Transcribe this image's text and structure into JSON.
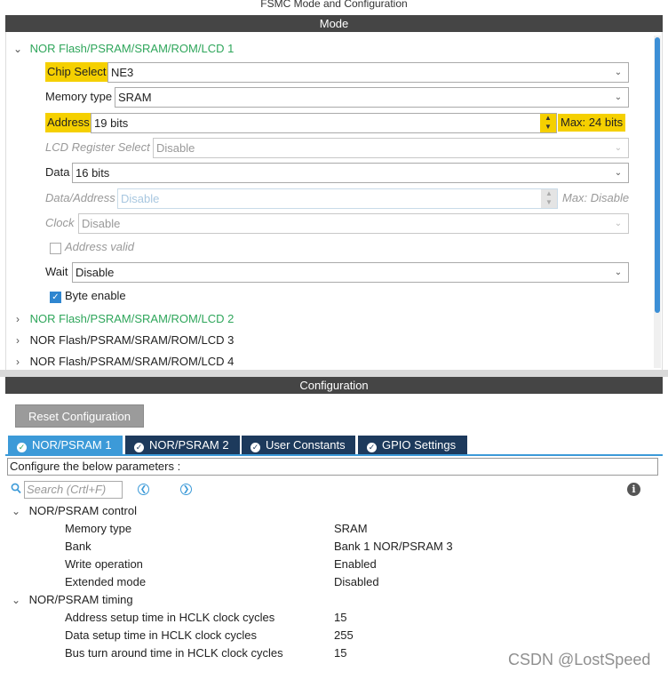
{
  "window": {
    "title": "FSMC Mode and Configuration"
  },
  "mode": {
    "header": "Mode",
    "sections": [
      {
        "label": "NOR Flash/PSRAM/SRAM/ROM/LCD 1"
      },
      {
        "label": "NOR Flash/PSRAM/SRAM/ROM/LCD 2"
      },
      {
        "label": "NOR Flash/PSRAM/SRAM/ROM/LCD 3"
      },
      {
        "label": "NOR Flash/PSRAM/SRAM/ROM/LCD 4"
      }
    ],
    "fields": {
      "chip_select": {
        "label": "Chip Select",
        "value": "NE3"
      },
      "memory_type": {
        "label": "Memory type",
        "value": "SRAM"
      },
      "address": {
        "label": "Address",
        "value": "19 bits",
        "max": "Max: 24 bits"
      },
      "lcd_register_select": {
        "label": "LCD Register Select",
        "value": "Disable"
      },
      "data": {
        "label": "Data",
        "value": "16 bits"
      },
      "data_address": {
        "label": "Data/Address",
        "value": "Disable",
        "max": "Max: Disable"
      },
      "clock": {
        "label": "Clock",
        "value": "Disable"
      },
      "address_valid": {
        "label": "Address valid",
        "checked": false
      },
      "wait": {
        "label": "Wait",
        "value": "Disable"
      },
      "byte_enable": {
        "label": "Byte enable",
        "checked": true
      }
    }
  },
  "config": {
    "header": "Configuration",
    "reset_label": "Reset Configuration",
    "tabs": [
      {
        "label": "NOR/PSRAM 1",
        "active": true
      },
      {
        "label": "NOR/PSRAM 2",
        "active": false
      },
      {
        "label": "User Constants",
        "active": false
      },
      {
        "label": "GPIO Settings",
        "active": false
      }
    ],
    "params_hint": "Configure the below parameters :",
    "search_placeholder": "Search (Crtl+F)",
    "groups": [
      {
        "label": "NOR/PSRAM control",
        "rows": [
          {
            "name": "Memory type",
            "value": "SRAM"
          },
          {
            "name": "Bank",
            "value": "Bank 1 NOR/PSRAM 3"
          },
          {
            "name": "Write operation",
            "value": "Enabled"
          },
          {
            "name": "Extended mode",
            "value": "Disabled"
          }
        ]
      },
      {
        "label": "NOR/PSRAM timing",
        "rows": [
          {
            "name": "Address setup time in HCLK clock cycles",
            "value": "15"
          },
          {
            "name": "Data setup time in HCLK clock cycles",
            "value": "255"
          },
          {
            "name": "Bus turn around time in HCLK clock cycles",
            "value": "15"
          }
        ]
      }
    ]
  },
  "watermark": "CSDN @LostSpeed",
  "colors": {
    "highlight": "#f5d000",
    "tab_active": "#3c9ad8",
    "tab_inactive": "#1d3a5c",
    "section_green": "#2fa65b",
    "header_bar": "#454545"
  }
}
